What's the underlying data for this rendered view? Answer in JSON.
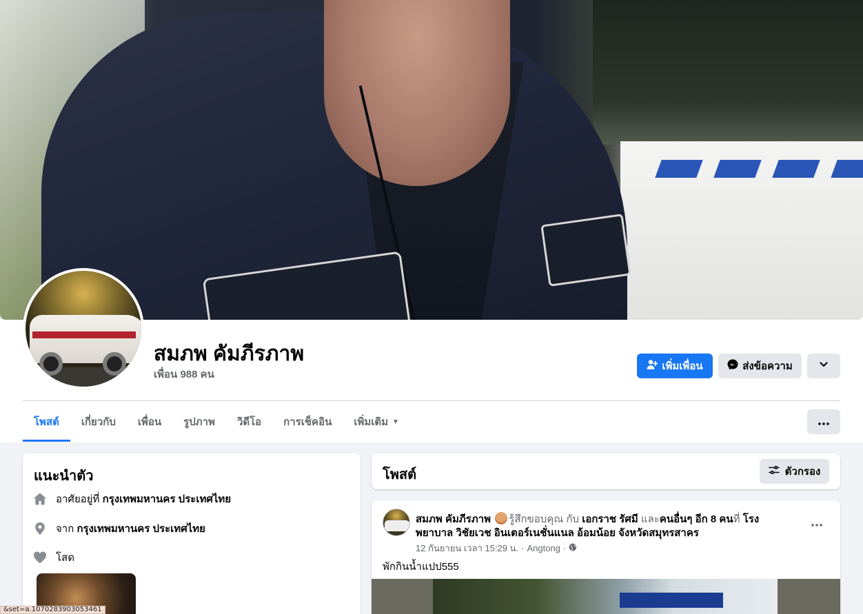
{
  "profile": {
    "name": "สมภพ คัมภีรภาพ",
    "friends_count": "เพื่อน 988 คน"
  },
  "actions": {
    "add_friend": "เพิ่มเพื่อน",
    "send_message": "ส่งข้อความ"
  },
  "tabs": [
    {
      "label": "โพสต์",
      "active": true
    },
    {
      "label": "เกี่ยวกับ"
    },
    {
      "label": "เพื่อน"
    },
    {
      "label": "รูปภาพ"
    },
    {
      "label": "วิดีโอ"
    },
    {
      "label": "การเช็คอิน"
    },
    {
      "label": "เพิ่มเติม"
    }
  ],
  "intro": {
    "title": "แนะนำตัว",
    "lives_prefix": "อาศัยอยู่ที่",
    "lives_place": "กรุงเทพมหานคร ประเทศไทย",
    "from_prefix": "จาก",
    "from_place": "กรุงเทพมหานคร ประเทศไทย",
    "relationship": "โสด"
  },
  "posts_header": {
    "title": "โพสต์",
    "filter": "ตัวกรอง"
  },
  "post": {
    "author": "สมภพ คัมภีรภาพ",
    "feeling": "รู้สึกขอบคุณ",
    "with_word": "กับ",
    "tagged": "เอกราช รัศมี",
    "and_word": "และ",
    "others": "คนอื่นๆ อีก 8 คน",
    "at_word": "ที่",
    "place": "โรงพยาบาล วิชัยเวช อินเตอร์เนชั่นแนล อ้อมน้อย จังหวัดสมุทรสาคร",
    "date": "12 กันยายน เวลา 15:29 น.",
    "location": "Angtong",
    "text": "พักกินน้ำแปป555"
  },
  "status_bar": {
    "url": "&set=a.1070283903053461"
  },
  "colors": {
    "accent": "#1877f2",
    "page_bg": "#f0f2f5",
    "secondary_text": "#65676b",
    "button_gray": "#e4e6eb"
  },
  "icons": [
    "user-plus-icon",
    "messenger-icon",
    "chevron-down-icon",
    "more-icon",
    "home-icon",
    "location-pin-icon",
    "heart-icon",
    "filter-icon",
    "globe-icon"
  ]
}
